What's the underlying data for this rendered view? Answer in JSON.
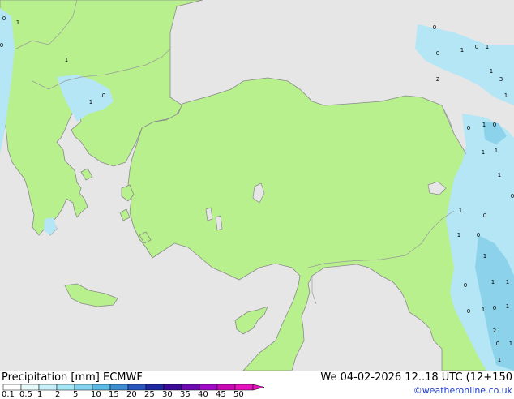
{
  "map": {
    "colors": {
      "sea": "#e6e6e6",
      "land": "#b7f08c",
      "coast": "#8a8a8a",
      "border": "#9a9a9a",
      "precip_light": "#b4e6f5",
      "precip_mid": "#8cd2eb"
    },
    "point_values": [
      "0",
      "1",
      "0",
      "1",
      "0",
      "1",
      "0",
      "0",
      "1",
      "0",
      "1",
      "1",
      "3",
      "1",
      "2",
      "0",
      "1",
      "0",
      "1",
      "1",
      "1",
      "0",
      "1",
      "0",
      "1",
      "0",
      "1",
      "1",
      "1",
      "0",
      "0",
      "1",
      "0",
      "1",
      "2",
      "0",
      "1",
      "1"
    ]
  },
  "footer": {
    "title": "Precipitation [mm]  ECMWF",
    "datetime": "We 04-02-2026 12..18 UTC (12+150",
    "credit": "©weatheronline.co.uk"
  },
  "legend": {
    "ticks": [
      "0.1",
      "0.5",
      "1",
      "2",
      "5",
      "10",
      "15",
      "20",
      "25",
      "30",
      "35",
      "40",
      "45",
      "50"
    ],
    "colors": [
      "#ffffff",
      "#e6fafa",
      "#c8f0fa",
      "#a5e6f5",
      "#82d2f0",
      "#5ab9e6",
      "#3c8cd2",
      "#2855be",
      "#1e28a0",
      "#3c0a96",
      "#6e0ab4",
      "#a00ac8",
      "#c80ab4",
      "#e614be"
    ]
  }
}
